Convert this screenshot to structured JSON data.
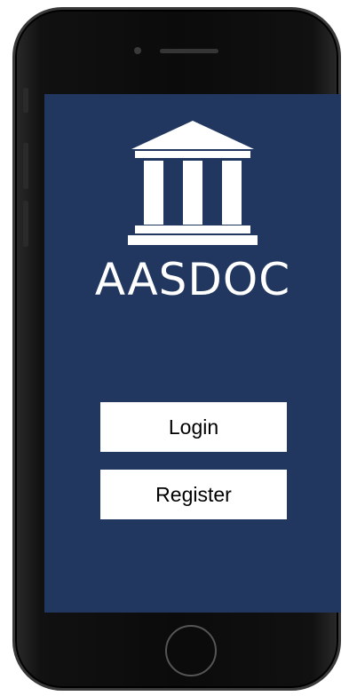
{
  "app": {
    "brand_name": "AASDOC"
  },
  "buttons": {
    "login_label": "Login",
    "register_label": "Register"
  },
  "icons": {
    "logo": "courthouse-icon",
    "home": "home-button-icon"
  },
  "colors": {
    "screen_background": "#22375f",
    "button_background": "#ffffff",
    "button_text": "#000000",
    "brand_text": "#ffffff"
  }
}
